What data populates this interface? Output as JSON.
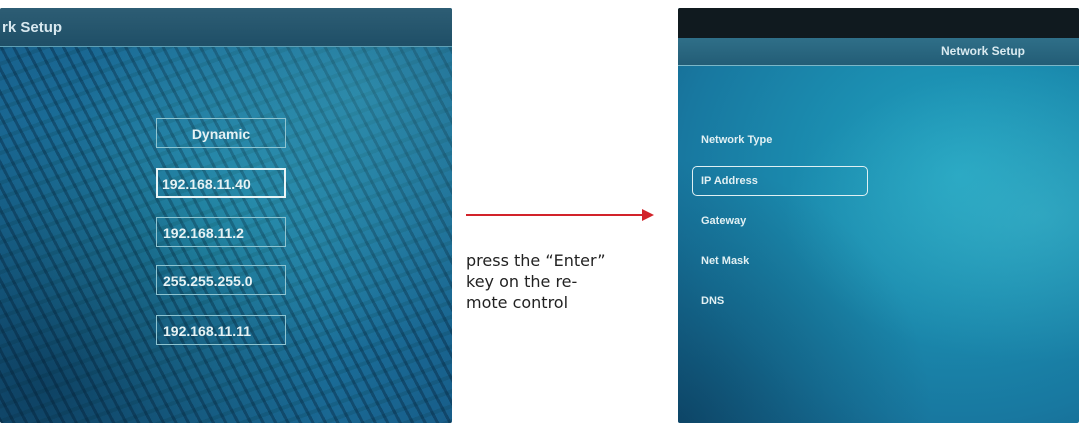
{
  "left_screen": {
    "title": "rk Setup",
    "fields": [
      {
        "value": "Dynamic"
      },
      {
        "value": "192.168.11.40"
      },
      {
        "value": "192.168.11.2"
      },
      {
        "value": "255.255.255.0"
      },
      {
        "value": "192.168.11.11"
      }
    ]
  },
  "caption": {
    "lines": [
      "press the “Enter”",
      "key on the re-",
      "mote control"
    ]
  },
  "right_screen": {
    "title": "Network Setup",
    "menu": [
      {
        "label": "Network Type"
      },
      {
        "label": "IP Address"
      },
      {
        "label": "Gateway"
      },
      {
        "label": "Net Mask"
      },
      {
        "label": "DNS"
      }
    ],
    "selected_index": 1
  },
  "colors": {
    "arrow": "#d2232a",
    "screen_blue": "#1b8db0"
  }
}
